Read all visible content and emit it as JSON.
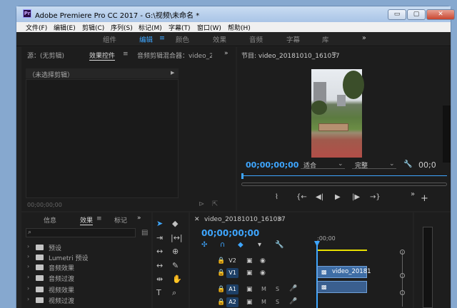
{
  "window": {
    "title": "Adobe Premiere Pro CC 2017 - G:\\视频\\未命名 *",
    "icon": "Pr",
    "min": "▭",
    "max": "▢",
    "close": "✕"
  },
  "menu": [
    "文件(F)",
    "编辑(E)",
    "剪辑(C)",
    "序列(S)",
    "标记(M)",
    "字幕(T)",
    "窗口(W)",
    "帮助(H)"
  ],
  "workspaces": {
    "items": [
      "组件",
      "编辑",
      "颜色",
      "效果",
      "音频",
      "字幕",
      "库"
    ],
    "active": "编辑",
    "more": "»",
    "menu_glyph": "≡"
  },
  "source_panel": {
    "tabs": [
      "源：(无剪辑)",
      "效果控件",
      "音频剪辑混合器：video_2"
    ],
    "active": "效果控件",
    "more": "»",
    "no_clip": "（未选择剪辑）",
    "timecode": "00;00;00;00"
  },
  "program": {
    "title": "节目: video_20181010_161037",
    "menu_glyph": "≡",
    "timecode": "00;00;00;00",
    "fit": "适合",
    "quality": "完整",
    "end_timecode": "00;0"
  },
  "project": {
    "tabs": [
      "信息",
      "效果",
      "标记"
    ],
    "active": "效果",
    "more": "»",
    "items": [
      "预设",
      "Lumetri 预设",
      "音频效果",
      "音频过渡",
      "视频效果",
      "视频过渡"
    ]
  },
  "timeline": {
    "title": "video_20181010_161037",
    "menu_glyph": "≡",
    "close": "✕",
    "timecode": "00;00;00;00",
    "ruler": ";00;00",
    "tracks": [
      {
        "name": "V2",
        "kind": "video"
      },
      {
        "name": "V1",
        "kind": "video",
        "targeted": true,
        "clip": "video_20181"
      },
      {
        "name": "A1",
        "kind": "audio",
        "targeted": true,
        "m": "M",
        "s": "S"
      },
      {
        "name": "A2",
        "kind": "audio",
        "targeted": true,
        "m": "M",
        "s": "S"
      }
    ]
  },
  "colors": {
    "accent": "#3ea6ff",
    "clip": "#3e6da5",
    "playhead": "#3ea6ff",
    "work_area": "#e8e000"
  }
}
